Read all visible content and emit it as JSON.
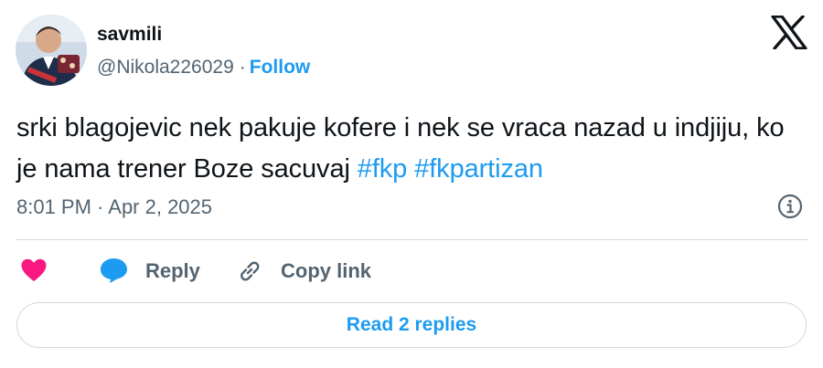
{
  "author": {
    "display_name": "savmili",
    "handle": "@Nikola226029",
    "separator": "·",
    "follow_label": "Follow",
    "avatar_icon": "user-photo-avatar"
  },
  "platform_icon": "x-logo-icon",
  "tweet": {
    "text_plain": "srki blagojevic nek pakuje kofere i nek se vraca nazad u indjiju, ko je nama trener Boze sacuvaj",
    "hashtags": [
      "#fkp",
      "#fkpartizan"
    ],
    "timestamp": "8:01 PM · Apr 2, 2025"
  },
  "actions": {
    "like_icon": "heart-icon",
    "reply_label": "Reply",
    "copy_link_label": "Copy link"
  },
  "replies_button": {
    "label": "Read 2 replies"
  },
  "colors": {
    "accent": "#1d9bf0",
    "text": "#0f1419",
    "secondary": "#536471",
    "heart": "#f91880",
    "border": "#cfd9de"
  }
}
